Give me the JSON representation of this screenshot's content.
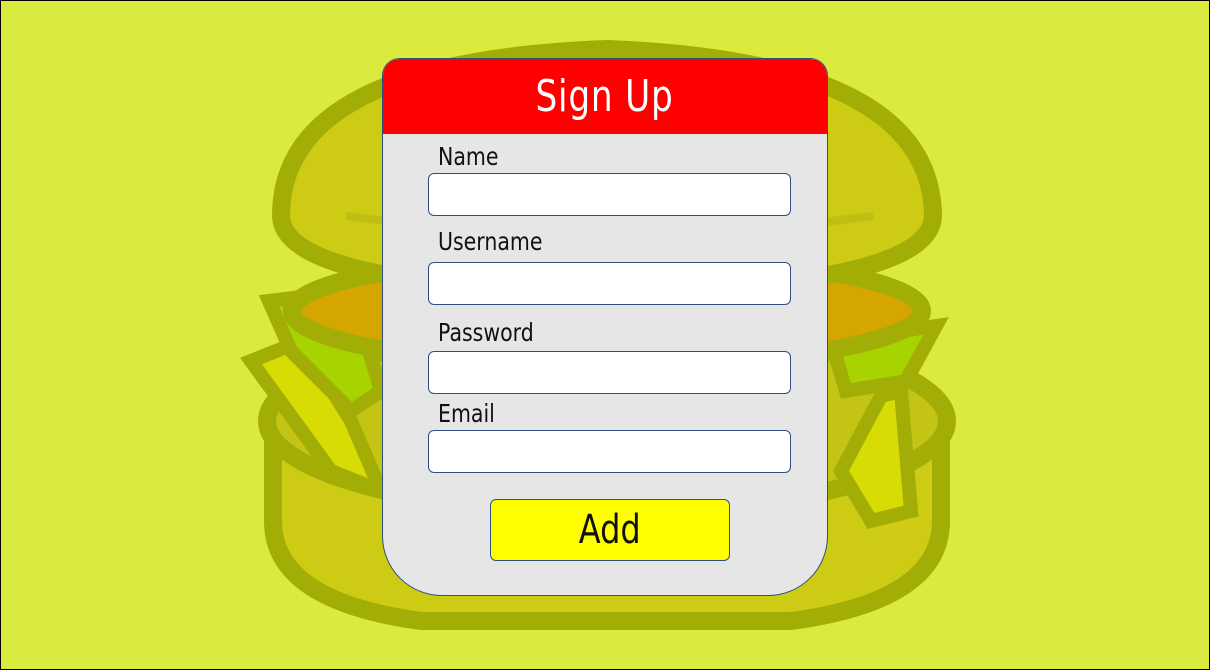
{
  "form": {
    "title": "Sign Up",
    "fields": [
      {
        "label": "Name",
        "value": "",
        "placeholder": ""
      },
      {
        "label": "Username",
        "value": "",
        "placeholder": ""
      },
      {
        "label": "Password",
        "value": "",
        "placeholder": ""
      },
      {
        "label": "Email",
        "value": "",
        "placeholder": ""
      }
    ],
    "submit_label": "Add"
  },
  "colors": {
    "background": "#dbea3f",
    "header": "#ff0000",
    "card": "#e6e6e6",
    "button": "#ffff00",
    "border": "#2f4f7f"
  },
  "icons": {
    "background_illustration": "burger-illustration"
  }
}
